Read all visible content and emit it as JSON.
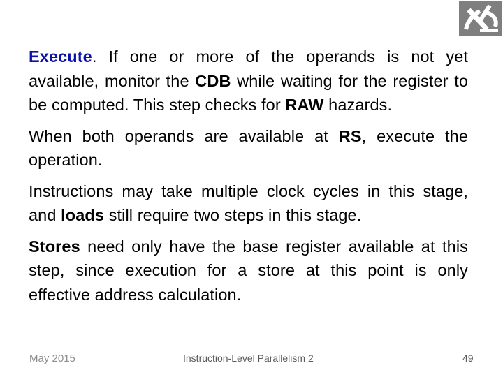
{
  "slide": {
    "paragraphs": [
      {
        "segments": [
          {
            "text": "Execute",
            "style": "accent"
          },
          {
            "text": ". If one or more of the operands is not yet available, monitor the ",
            "style": "normal"
          },
          {
            "text": "CDB",
            "style": "bold"
          },
          {
            "text": " while waiting for the register to be computed. This step checks for ",
            "style": "normal"
          },
          {
            "text": "RAW",
            "style": "bold"
          },
          {
            "text": " hazards.",
            "style": "normal"
          }
        ]
      },
      {
        "segments": [
          {
            "text": "When both operands are available at ",
            "style": "normal"
          },
          {
            "text": "RS",
            "style": "bold"
          },
          {
            "text": ", execute the operation.",
            "style": "normal"
          }
        ]
      },
      {
        "segments": [
          {
            "text": "Instructions may take multiple clock cycles in this stage, and ",
            "style": "normal"
          },
          {
            "text": "loads",
            "style": "bold"
          },
          {
            "text": " still require two steps in this stage.",
            "style": "normal"
          }
        ]
      },
      {
        "segments": [
          {
            "text": "Stores",
            "style": "bold"
          },
          {
            "text": " need only have the base register available at this step, since execution for a store at this point is only effective address calculation.",
            "style": "normal"
          }
        ]
      }
    ]
  },
  "footer": {
    "date": "May 2015",
    "title": "Instruction-Level Parallelism 2",
    "page": "49"
  },
  "logo": {
    "icon": "technion-logo-icon",
    "background": "#7f7f7f"
  },
  "colors": {
    "accent": "#0c12a8"
  }
}
